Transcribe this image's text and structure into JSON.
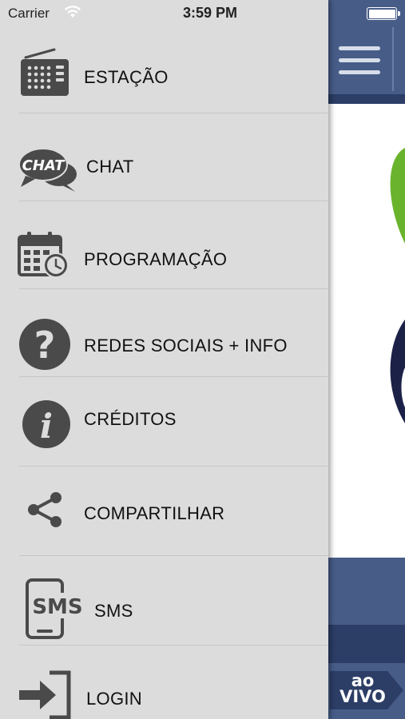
{
  "status_bar": {
    "carrier": "Carrier",
    "time": "3:59 PM"
  },
  "menu": {
    "items": [
      {
        "label": "ESTAÇÃO",
        "icon": "radio-icon"
      },
      {
        "label": "CHAT",
        "icon": "chat-icon",
        "icon_text": "CHAT"
      },
      {
        "label": "PROGRAMAÇÃO",
        "icon": "calendar-clock-icon"
      },
      {
        "label": "REDES SOCIAIS + INFO",
        "icon": "question-icon",
        "icon_text": "?"
      },
      {
        "label": "CRÉDITOS",
        "icon": "info-icon",
        "icon_text": "i"
      },
      {
        "label": "COMPARTILHAR",
        "icon": "share-icon"
      },
      {
        "label": "SMS",
        "icon": "sms-phone-icon",
        "icon_text": "SMS"
      },
      {
        "label": "LOGIN",
        "icon": "login-icon"
      }
    ]
  },
  "background_app": {
    "live_badge": "ao\nVIVO"
  },
  "colors": {
    "drawer_bg": "#dcdcdc",
    "icon_dark": "#4a4a4a",
    "header_blue": "#475d88",
    "header_dark": "#2c3e66",
    "logo_green": "#6ab42d",
    "logo_navy": "#1c2147"
  }
}
